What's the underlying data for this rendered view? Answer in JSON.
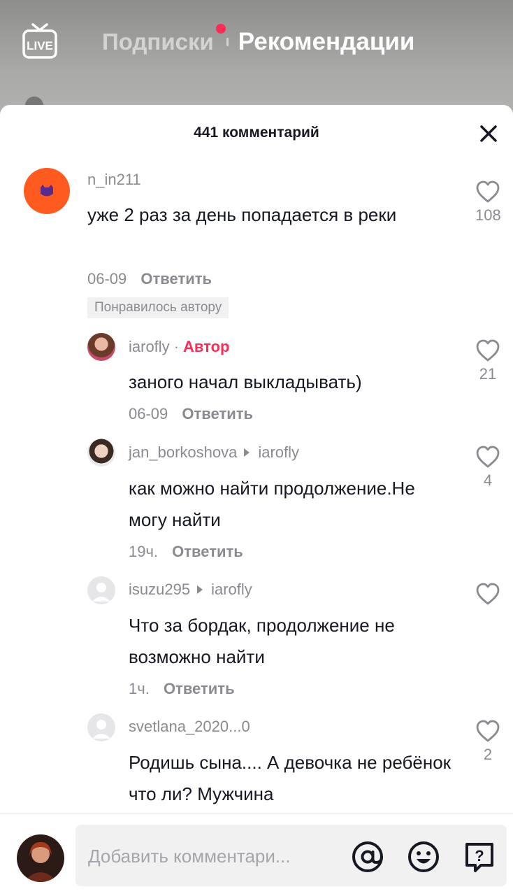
{
  "header": {
    "live_label": "LIVE",
    "tab_following": "Подписки",
    "tab_recommended": "Рекомендации"
  },
  "sheet": {
    "title": "441 комментарий"
  },
  "comments": [
    {
      "username": "n_in211",
      "text": "уже 2 раз за день попадается в реки",
      "date": "06-09",
      "reply_label": "Ответить",
      "badge": "Понравилось автору",
      "likes": "108"
    },
    {
      "username": "iarofly",
      "author_badge": "Автор",
      "bullet": "·",
      "text": "заного начал выкладывать)",
      "date": "06-09",
      "reply_label": "Ответить",
      "likes": "21"
    },
    {
      "username": "jan_borkoshova",
      "reply_to": "iarofly",
      "text": "как можно найти продолжение.Не могу найти",
      "date": "19ч.",
      "reply_label": "Ответить",
      "likes": "4"
    },
    {
      "username": "isuzu295",
      "reply_to": "iarofly",
      "text": "Что за бордак, продолжение не возможно найти",
      "date": "1ч.",
      "reply_label": "Ответить",
      "likes": ""
    },
    {
      "username": "svetlana_2020...0",
      "text": "Родишь сына.... А девочка не ребёнок что ли? Мужчина",
      "likes": "2"
    }
  ],
  "composer": {
    "placeholder": "Добавить комментари..."
  },
  "icons": {
    "live": "live-tv-icon",
    "close": "close-icon",
    "like": "heart-outline-icon",
    "mention": "at-sign-icon",
    "emoji": "emoji-icon",
    "question": "question-bubble-icon"
  },
  "colors": {
    "accent": "#fe2c55",
    "text": "#161823",
    "muted": "#8a8b91"
  }
}
